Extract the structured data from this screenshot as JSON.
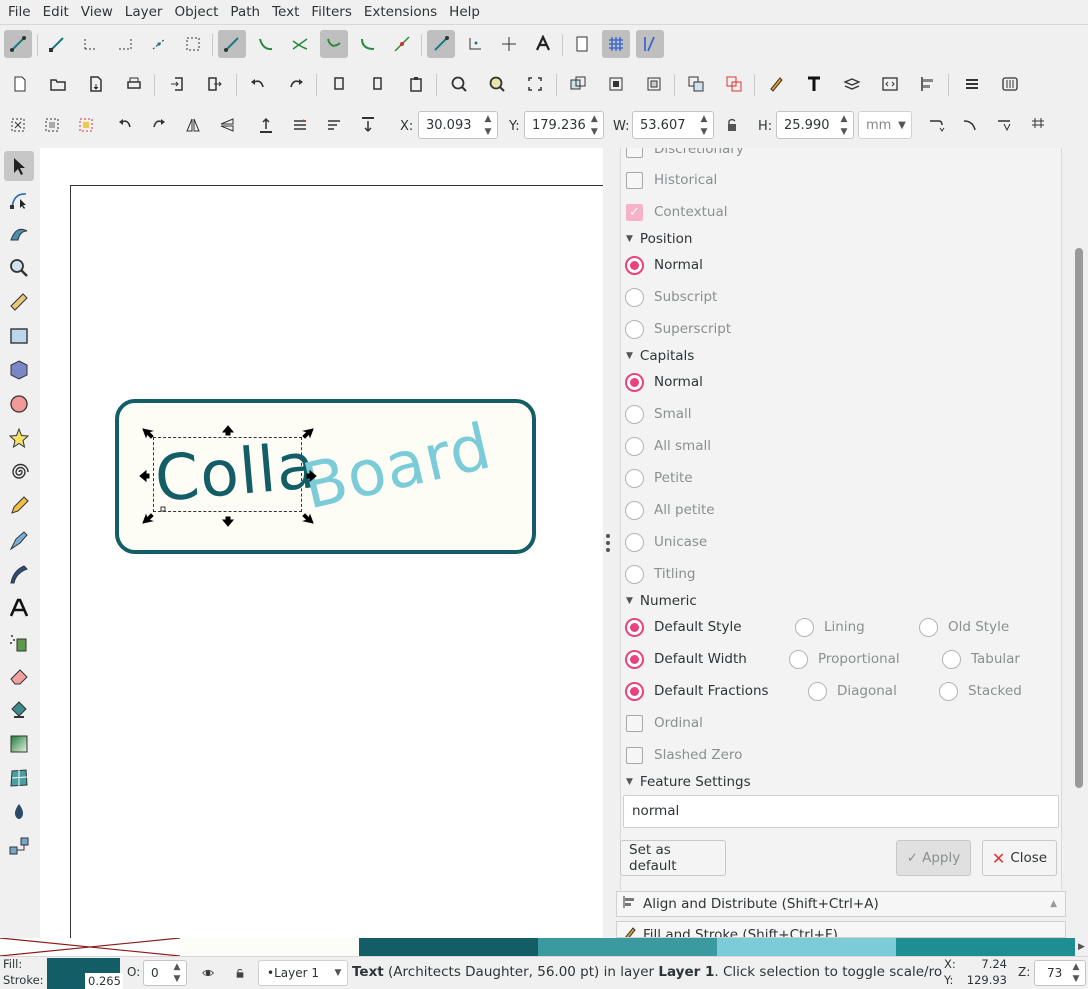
{
  "menu": [
    "File",
    "Edit",
    "View",
    "Layer",
    "Object",
    "Path",
    "Text",
    "Filters",
    "Extensions",
    "Help"
  ],
  "coords": {
    "x_label": "X:",
    "x_value": "30.093",
    "y_label": "Y:",
    "y_value": "179.236",
    "w_label": "W:",
    "w_value": "53.607",
    "h_label": "H:",
    "h_value": "25.990",
    "unit": "mm"
  },
  "canvas": {
    "text1": "Colla",
    "text2": "Board",
    "color1": "#135e66",
    "color2": "#7ccbd8",
    "frame_color": "#135e66"
  },
  "panel": {
    "top_partial": "Discretionary",
    "historical": "Historical",
    "contextual": "Contextual",
    "position": {
      "title": "Position",
      "options": [
        "Normal",
        "Subscript",
        "Superscript"
      ]
    },
    "capitals": {
      "title": "Capitals",
      "options": [
        "Normal",
        "Small",
        "All small",
        "Petite",
        "All petite",
        "Unicase",
        "Titling"
      ]
    },
    "numeric": {
      "title": "Numeric",
      "row1": [
        "Default Style",
        "Lining",
        "Old Style"
      ],
      "row2": [
        "Default Width",
        "Proportional",
        "Tabular"
      ],
      "row3": [
        "Default Fractions",
        "Diagonal",
        "Stacked"
      ],
      "ordinal": "Ordinal",
      "slashed_zero": "Slashed Zero"
    },
    "feature_settings": {
      "title": "Feature Settings",
      "value": "normal"
    },
    "set_default": "Set as default",
    "apply": "Apply",
    "close": "Close"
  },
  "docks": {
    "align": "Align and Distribute (Shift+Ctrl+A)",
    "fill": "Fill and Stroke (Shift+Ctrl+F)"
  },
  "palette": [
    "#ffffff",
    "#fdfdf8",
    "#135e66",
    "#3b9aa0",
    "#7ccbd8",
    "#1f8e92"
  ],
  "status": {
    "fill_label": "Fill:",
    "stroke_label": "Stroke:",
    "stroke_width": "0.265",
    "opacity_label": "O:",
    "opacity_value": "0",
    "layer": "•Layer 1",
    "msg_bold": "Text",
    "msg_rest": " (Architects Daughter, 56.00 pt) in layer ",
    "msg_layer": "Layer 1",
    "msg_end": ". Click selection to toggle scale/rot...",
    "cx_label": "X:",
    "cx": "7.24",
    "cy_label": "Y:",
    "cy": "129.93",
    "zoom_label": "Z:",
    "zoom": "73",
    "fill_color": "#135e66"
  }
}
